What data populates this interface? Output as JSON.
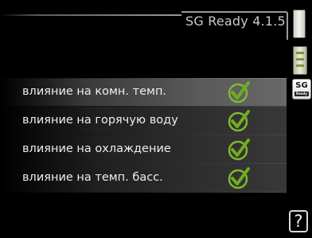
{
  "header": {
    "title": "SG Ready 4.1.5"
  },
  "side_icons": {
    "scroll_icon": "scrollbar-thumb",
    "gauge_icon": "temperature-gauge-icon",
    "sg_icon_text": "SG",
    "sg_icon_subtext": "Ready"
  },
  "rows": [
    {
      "label": "влияние на комн. темп.",
      "checked": true,
      "selected": true
    },
    {
      "label": "влияние на горячую воду",
      "checked": true,
      "selected": false
    },
    {
      "label": "влияние на охлаждение",
      "checked": true,
      "selected": false
    },
    {
      "label": "влияние на темп. басс.",
      "checked": true,
      "selected": false
    }
  ],
  "help": {
    "label": "?"
  },
  "colors": {
    "background": "#000000",
    "check_green": "#6fae1e",
    "text": "#ededed"
  }
}
